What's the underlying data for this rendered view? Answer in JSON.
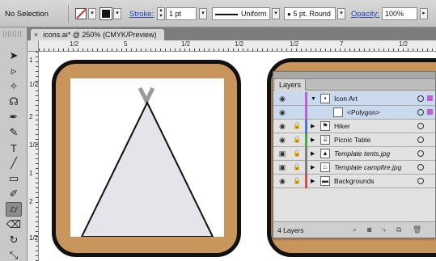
{
  "control_bar": {
    "selection_label": "No Selection",
    "stroke_label": "Stroke:",
    "stroke_weight": "1 pt",
    "profile_label": "Uniform",
    "brush_label": "5 pt. Round",
    "opacity_label": "Opacity:",
    "opacity_value": "100%"
  },
  "document_tab": {
    "close": "×",
    "title": "icons.ai* @ 250% (CMYK/Preview)"
  },
  "rulers": {
    "h_ticks": [
      "1/2",
      "5",
      "1/2",
      "1/2",
      "1/2",
      "7",
      "1/2"
    ],
    "v_ticks": [
      "1",
      "1/2",
      "2",
      "1/2",
      "1",
      "2",
      "1/2"
    ]
  },
  "tools": [
    {
      "name": "selection-tool-icon",
      "glyph": "➤"
    },
    {
      "name": "direct-selection-tool-icon",
      "glyph": "▹"
    },
    {
      "name": "magic-wand-tool-icon",
      "glyph": "✧"
    },
    {
      "name": "lasso-tool-icon",
      "glyph": "☊"
    },
    {
      "name": "pen-tool-icon",
      "glyph": "✒"
    },
    {
      "name": "curvature-tool-icon",
      "glyph": "✎"
    },
    {
      "name": "type-tool-icon",
      "glyph": "T"
    },
    {
      "name": "line-tool-icon",
      "glyph": "╱"
    },
    {
      "name": "rectangle-tool-icon",
      "glyph": "▭"
    },
    {
      "name": "paintbrush-tool-icon",
      "glyph": "✐"
    },
    {
      "name": "shaper-tool-icon",
      "glyph": "⌭"
    },
    {
      "name": "eraser-tool-icon",
      "glyph": "⌫"
    },
    {
      "name": "rotate-tool-icon",
      "glyph": "↻"
    },
    {
      "name": "scale-tool-icon",
      "glyph": "⤡"
    }
  ],
  "layers_panel": {
    "tab_label": "Layers",
    "footer_count": "4 Layers",
    "rows": [
      {
        "name": "Icon Art",
        "thumb": "▪",
        "expanded": true,
        "indent": false,
        "selected": true,
        "color": "#c060d0",
        "italic": false
      },
      {
        "name": "<Polygon>",
        "thumb": "",
        "expanded": null,
        "indent": true,
        "selected": true,
        "color": "#c060d0",
        "italic": false
      },
      {
        "name": "Hiker",
        "thumb": "⚑",
        "expanded": false,
        "indent": false,
        "selected": false,
        "color": "#4a78d8",
        "italic": false
      },
      {
        "name": "Picnic Table",
        "thumb": "⌸",
        "expanded": false,
        "indent": false,
        "selected": false,
        "color": "#4aa44a",
        "italic": false
      },
      {
        "name": "Template tents.jpg",
        "thumb": "▲",
        "expanded": false,
        "indent": false,
        "selected": false,
        "color": "#7d7d7d",
        "italic": true
      },
      {
        "name": "Template campfire.jpg",
        "thumb": "♨",
        "expanded": false,
        "indent": false,
        "selected": false,
        "color": "#7d7d7d",
        "italic": true
      },
      {
        "name": "Backgrounds",
        "thumb": "▬",
        "expanded": false,
        "indent": false,
        "selected": false,
        "color": "#d05050",
        "italic": false
      }
    ]
  },
  "colors": {
    "icon_background": "#c8965d",
    "triangle_fill": "#e4e4ea",
    "selection_blue": "#c9d9ee"
  }
}
